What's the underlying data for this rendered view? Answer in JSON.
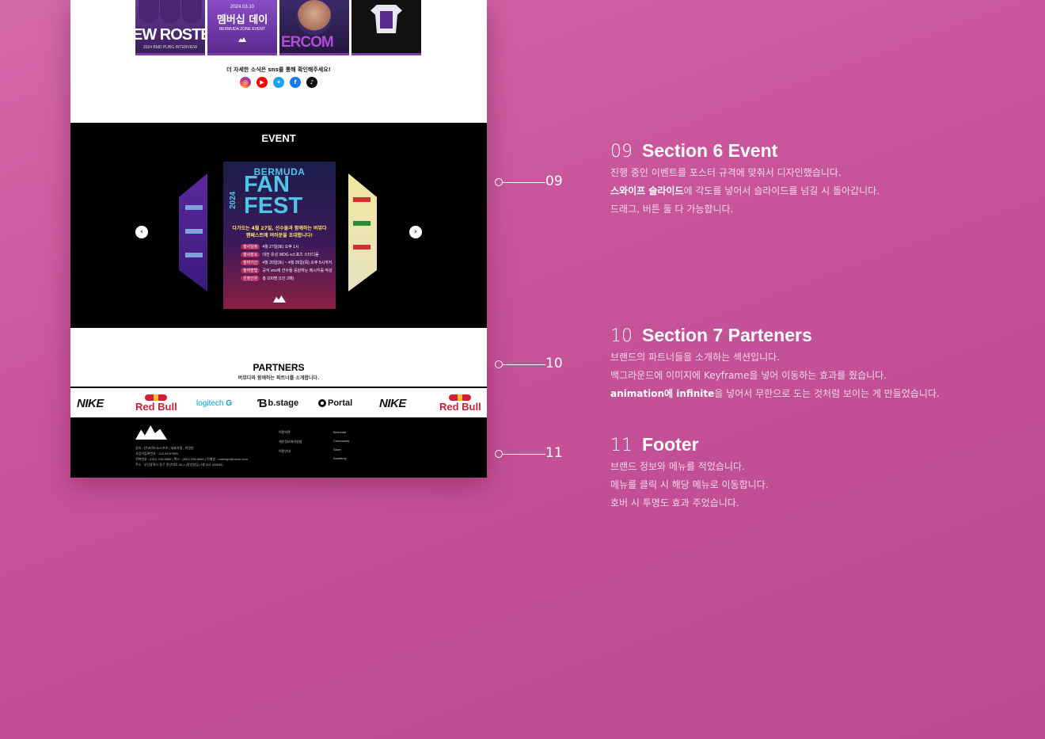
{
  "news": {
    "cards": [
      {
        "big": "EW ROSTE",
        "caption": "2024 BMD PUBG INTERVIEW"
      },
      {
        "date": "2024.03.10",
        "big": "멤버십 데이",
        "sub": "BERMUDA ZONE EVENT"
      },
      {
        "big": "ERCOM"
      },
      {
        "caption": ""
      }
    ]
  },
  "sns": {
    "text": "더 자세한 소식은 sns를 통해 확인해주세요!",
    "icons": [
      "instagram-icon",
      "youtube-icon",
      "twitter-icon",
      "facebook-icon",
      "tiktok-icon"
    ]
  },
  "event": {
    "title": "EVENT",
    "poster": {
      "line1": "BERMUDA",
      "year": "2024",
      "line2": "FAN",
      "line3": "FEST",
      "copy": "다가오는 4월 27일, 선수들과 함께하는 버뮤다 팬페스트에 여러분을 초대합니다!",
      "rows": [
        {
          "label": "행사일정",
          "value": "4월 27일(토) 오후 1시"
        },
        {
          "label": "행사장소",
          "value": "대전 유성 WDG e스포츠 스타디움"
        },
        {
          "label": "참여기간",
          "value": "4월 20일(토) ~ 4월 25일(목) 오후 5시까지"
        },
        {
          "label": "참여방법",
          "value": "공식 sns에 선수들 응원하는 메시지를 작성"
        },
        {
          "label": "선정인원",
          "value": "총 100명 (1인 2매)"
        }
      ]
    },
    "prev_label": "‹",
    "next_label": "›"
  },
  "partners": {
    "title": "PARTNERS",
    "subtitle": "버뮤다와 함께하는 파트너를 소개합니다.",
    "logos": [
      "NIKE",
      "Red Bull",
      "logitech",
      "b.stage",
      "Portal",
      "NIKE",
      "Red Bull"
    ]
  },
  "footer": {
    "info": [
      "상호 : (주)버뮤다e스포츠 | 대표자명 : 박정현",
      "사업자등록번호 : 123-45-67890",
      "전화번호 : (051) 245-5660 | 팩스 : (051) 245-5660 | 이메일 : mdesign@naver.com",
      "주소 : 부산광역시 중구 중앙대로 30-1 (중앙빌딩) 3층 501 (48943)"
    ],
    "col1": [
      "이용약관",
      "개인정보처리방침",
      "이용안내"
    ],
    "col2": [
      "Bermuda",
      "Community",
      "Store",
      "Academy"
    ]
  },
  "callouts": [
    "09",
    "10",
    "11"
  ],
  "sections": [
    {
      "num": "09",
      "title": "Section 6  Event",
      "lines": [
        {
          "bold": "",
          "text": "진행 중인 이벤트를 포스터 규격에 맞춰서 디자인했습니다."
        },
        {
          "bold": "스와이프 슬라이드",
          "text": "에 각도를 넣어서 슬라이드를 넘길 시 돌아갑니다."
        },
        {
          "bold": "",
          "text": "드래그, 버튼 둘 다 가능합니다."
        }
      ]
    },
    {
      "num": "10",
      "title": "Section 7 Parteners",
      "lines": [
        {
          "bold": "",
          "text": "브랜드의 파트너들을 소개하는 섹션입니다."
        },
        {
          "bold": "",
          "text": "백그라운드에 이미지에 Keyframe을 넣어 이동하는 효과를 줬습니다."
        },
        {
          "bold": "animation에 infinite",
          "text": "을 넣어서 무한으로 도는 것처럼 보이는 게 만들었습니다."
        }
      ]
    },
    {
      "num": "11",
      "title": "Footer",
      "lines": [
        {
          "bold": "",
          "text": "브랜드 정보와 메뉴를 적었습니다."
        },
        {
          "bold": "",
          "text": "메뉴를 클릭 시 해당 메뉴로 이동합니다."
        },
        {
          "bold": "",
          "text": "호버 시 투명도 효과 주었습니다."
        }
      ]
    }
  ]
}
